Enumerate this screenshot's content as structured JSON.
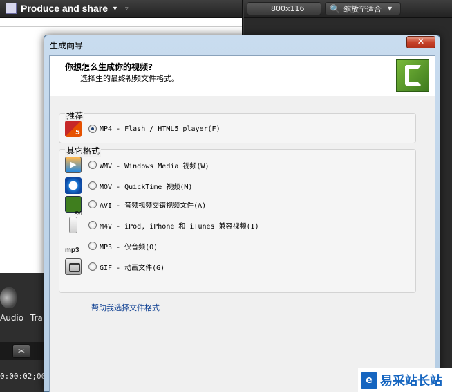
{
  "app": {
    "produce_menu": "Produce and share",
    "resolution": "800x116",
    "zoom_label": "缩放至适合",
    "audio_label": "Audio",
    "track_label": "Tra",
    "timecode": "0:00:02;00"
  },
  "dialog": {
    "title": "生成向导",
    "close_glyph": "✕",
    "question": "你想怎么生成你的视频?",
    "instruction": "选择生的最终视频文件格式。",
    "recommended": {
      "label": "推荐",
      "options": [
        {
          "icon": "html5-flash-icon",
          "text": "MP4 - Flash / HTML5 player(F)",
          "selected": true
        }
      ]
    },
    "other": {
      "label": "其它格式",
      "options": [
        {
          "icon": "windows-media-icon",
          "text": "WMV - Windows Media 视频(W)",
          "selected": false
        },
        {
          "icon": "quicktime-icon",
          "text": "MOV - QuickTime 视频(M)",
          "selected": false
        },
        {
          "icon": "avi-icon",
          "text": "AVI - 音频视频交错视频文件(A)",
          "selected": false
        },
        {
          "icon": "ipod-icon",
          "text": "M4V - iPod, iPhone 和 iTunes 兼容视频(I)",
          "selected": false
        },
        {
          "icon": "mp3-icon",
          "text": "MP3 - 仅音频(O)",
          "selected": false
        },
        {
          "icon": "gif-icon",
          "text": "GIF - 动画文件(G)",
          "selected": false
        }
      ]
    },
    "help_link": "帮助我选择文件格式"
  },
  "watermark": {
    "letter": "e",
    "text": "易采站长站"
  },
  "colors": {
    "dialog_frame": "#b5cde4",
    "client_bg": "#f0f0f0",
    "link": "#0b3d91",
    "close_red": "#c7422a"
  }
}
